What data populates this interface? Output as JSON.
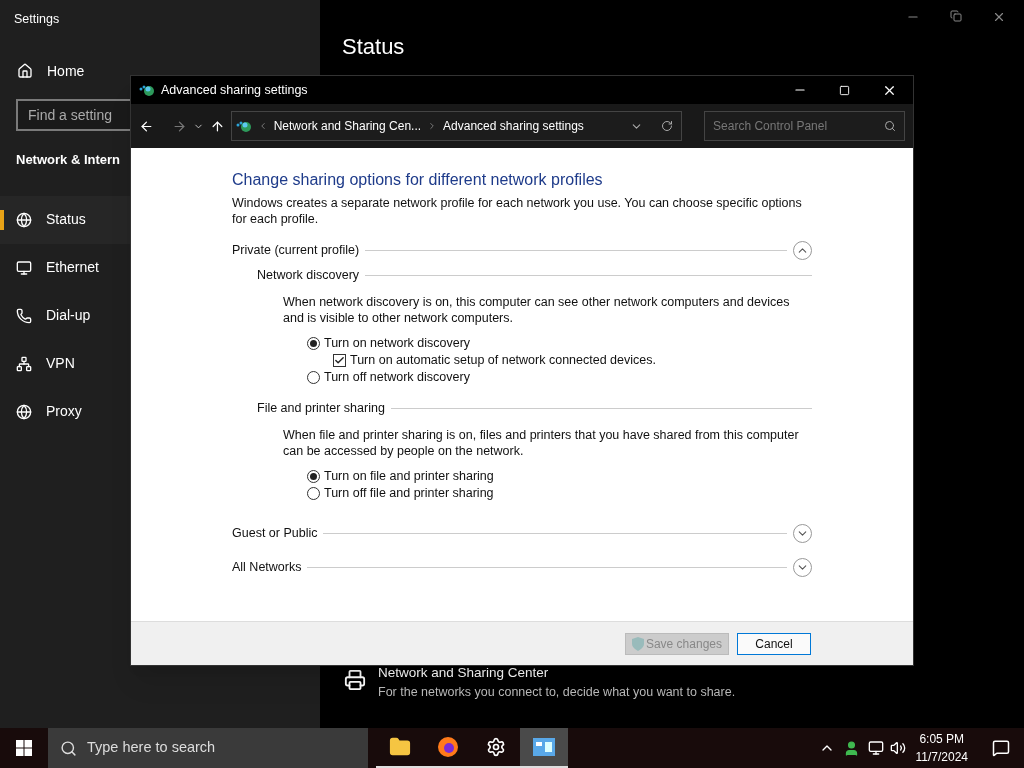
{
  "settings": {
    "title": "Settings",
    "home": "Home",
    "search": {
      "placeholder": "Find a setting"
    },
    "section": "Network & Intern",
    "nav": [
      {
        "label": "Status",
        "selected": true
      },
      {
        "label": "Ethernet",
        "selected": false
      },
      {
        "label": "Dial-up",
        "selected": false
      },
      {
        "label": "VPN",
        "selected": false
      },
      {
        "label": "Proxy",
        "selected": false
      }
    ],
    "page_title": "Status",
    "link": {
      "title": "Network and Sharing Center",
      "description": "For the networks you connect to, decide what you want to share."
    }
  },
  "dialog": {
    "title": "Advanced sharing settings",
    "breadcrumbs": [
      "Network and Sharing Cen...",
      "Advanced sharing settings"
    ],
    "search": {
      "placeholder": "Search Control Panel"
    },
    "heading": "Change sharing options for different network profiles",
    "intro": "Windows creates a separate network profile for each network you use. You can choose specific options for each profile.",
    "profiles": [
      {
        "name": "Private (current profile)",
        "expanded": true,
        "groups": [
          {
            "title": "Network discovery",
            "description": "When network discovery is on, this computer can see other network computers and devices and is visible to other network computers.",
            "options": [
              {
                "kind": "radio",
                "label": "Turn on network discovery",
                "selected": true,
                "children": [
                  {
                    "kind": "checkbox",
                    "label": "Turn on automatic setup of network connected devices.",
                    "checked": true
                  }
                ]
              },
              {
                "kind": "radio",
                "label": "Turn off network discovery",
                "selected": false
              }
            ]
          },
          {
            "title": "File and printer sharing",
            "description": "When file and printer sharing is on, files and printers that you have shared from this computer can be accessed by people on the network.",
            "options": [
              {
                "kind": "radio",
                "label": "Turn on file and printer sharing",
                "selected": true
              },
              {
                "kind": "radio",
                "label": "Turn off file and printer sharing",
                "selected": false
              }
            ]
          }
        ]
      },
      {
        "name": "Guest or Public",
        "expanded": false
      },
      {
        "name": "All Networks",
        "expanded": false
      }
    ],
    "buttons": [
      {
        "kind": "shield",
        "label": "Save changes",
        "disabled": true
      },
      {
        "kind": "plain",
        "label": "Cancel",
        "disabled": false
      }
    ]
  },
  "taskbar": {
    "search": {
      "placeholder": "Type here to search"
    },
    "apps": [
      {
        "kind": "folder",
        "active": false
      },
      {
        "kind": "browser",
        "active": false
      },
      {
        "kind": "gear",
        "active": false
      },
      {
        "kind": "panel",
        "active": true
      }
    ],
    "time": "6:05 PM",
    "date": "11/7/2024"
  }
}
